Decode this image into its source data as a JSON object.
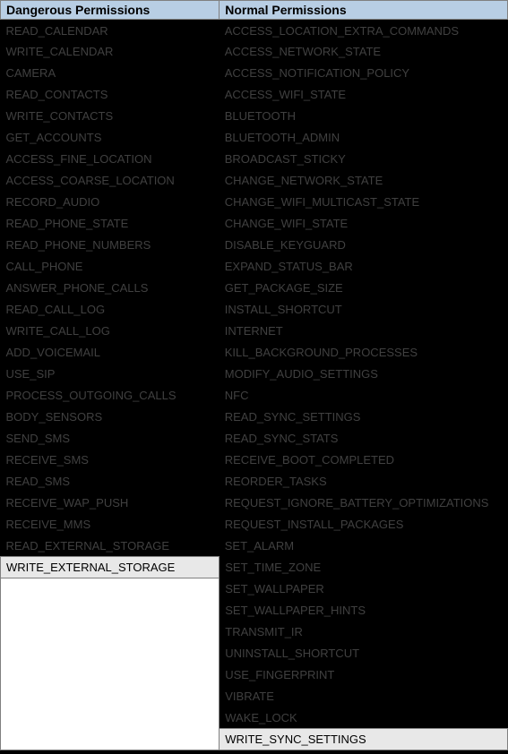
{
  "headers": {
    "dangerous": "Dangerous Permissions",
    "normal": "Normal Permissions"
  },
  "dangerous": [
    "READ_CALENDAR",
    "WRITE_CALENDAR",
    "CAMERA",
    "READ_CONTACTS",
    "WRITE_CONTACTS",
    "GET_ACCOUNTS",
    "ACCESS_FINE_LOCATION",
    "ACCESS_COARSE_LOCATION",
    "RECORD_AUDIO",
    "READ_PHONE_STATE",
    "READ_PHONE_NUMBERS",
    "CALL_PHONE",
    "ANSWER_PHONE_CALLS",
    "READ_CALL_LOG",
    "WRITE_CALL_LOG",
    "ADD_VOICEMAIL",
    "USE_SIP",
    "PROCESS_OUTGOING_CALLS",
    "BODY_SENSORS",
    "SEND_SMS",
    "RECEIVE_SMS",
    "READ_SMS",
    "RECEIVE_WAP_PUSH",
    "RECEIVE_MMS",
    "READ_EXTERNAL_STORAGE",
    "WRITE_EXTERNAL_STORAGE"
  ],
  "normal": [
    "ACCESS_LOCATION_EXTRA_COMMANDS",
    "ACCESS_NETWORK_STATE",
    "ACCESS_NOTIFICATION_POLICY",
    "ACCESS_WIFI_STATE",
    "BLUETOOTH",
    "BLUETOOTH_ADMIN",
    "BROADCAST_STICKY",
    "CHANGE_NETWORK_STATE",
    "CHANGE_WIFI_MULTICAST_STATE",
    "CHANGE_WIFI_STATE",
    "DISABLE_KEYGUARD",
    "EXPAND_STATUS_BAR",
    "GET_PACKAGE_SIZE",
    "INSTALL_SHORTCUT",
    "INTERNET",
    "KILL_BACKGROUND_PROCESSES",
    "MODIFY_AUDIO_SETTINGS",
    "NFC",
    "READ_SYNC_SETTINGS",
    "READ_SYNC_STATS",
    "RECEIVE_BOOT_COMPLETED",
    "REORDER_TASKS",
    "REQUEST_IGNORE_BATTERY_OPTIMIZATIONS",
    "REQUEST_INSTALL_PACKAGES",
    "SET_ALARM",
    "SET_TIME_ZONE",
    "SET_WALLPAPER",
    "SET_WALLPAPER_HINTS",
    "TRANSMIT_IR",
    "UNINSTALL_SHORTCUT",
    "USE_FINGERPRINT",
    "VIBRATE",
    "WAKE_LOCK",
    "WRITE_SYNC_SETTINGS"
  ],
  "dangerous_highlighted_index": 25,
  "normal_highlighted_index": 33
}
